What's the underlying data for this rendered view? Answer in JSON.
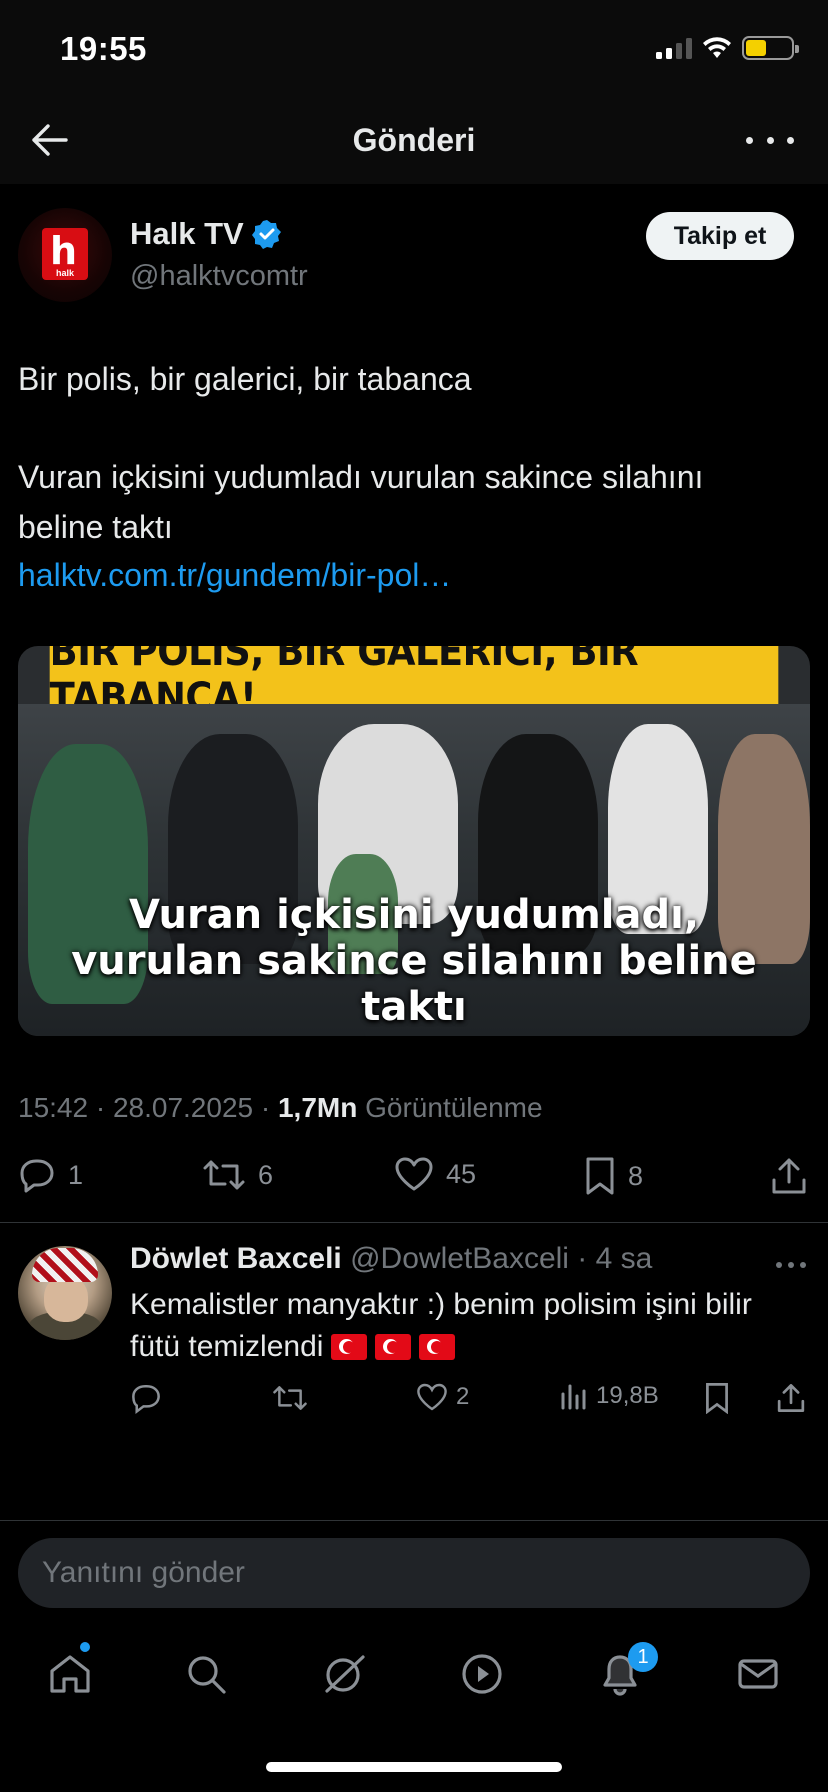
{
  "status": {
    "time": "19:55"
  },
  "nav": {
    "title": "Gönderi"
  },
  "post": {
    "author": {
      "name": "Halk TV",
      "handle": "@halktvcomtr",
      "logo_text": "h",
      "logo_sub": "halk"
    },
    "follow_label": "Takip et",
    "text_line1": "Bir polis, bir galerici, bir tabanca",
    "text_line2": "Vuran içkisini yudumladı vurulan sakince silahını",
    "text_line3": "beline taktı",
    "link": "halktv.com.tr/gundem/bir-pol…",
    "media": {
      "banner": "BİR POLİS, BİR GALERİCİ, BİR TABANCA!",
      "caption1": "Vuran içkisini yudumladı,",
      "caption2": "vurulan sakince silahını beline taktı"
    },
    "timestamp": "15:42 · 28.07.2025 · ",
    "views_count": "1,7Mn",
    "views_label": " Görüntülenme",
    "actions": {
      "replies": "1",
      "reposts": "6",
      "likes": "45",
      "bookmarks": "8"
    }
  },
  "reply": {
    "name": "Döwlet Baxceli",
    "handle": "@DowletBaxceli · 4 sa",
    "line1": "Kemalistler manyaktır :) benim polisim işini bilir",
    "line2": "fütü temizlendi",
    "likes": "2",
    "views": "19,8B"
  },
  "compose": {
    "placeholder": "Yanıtını gönder"
  },
  "notifications_badge": "1",
  "colors": {
    "accent": "#1d9bf0",
    "banner": "#f3c21a",
    "bg": "#000000"
  }
}
